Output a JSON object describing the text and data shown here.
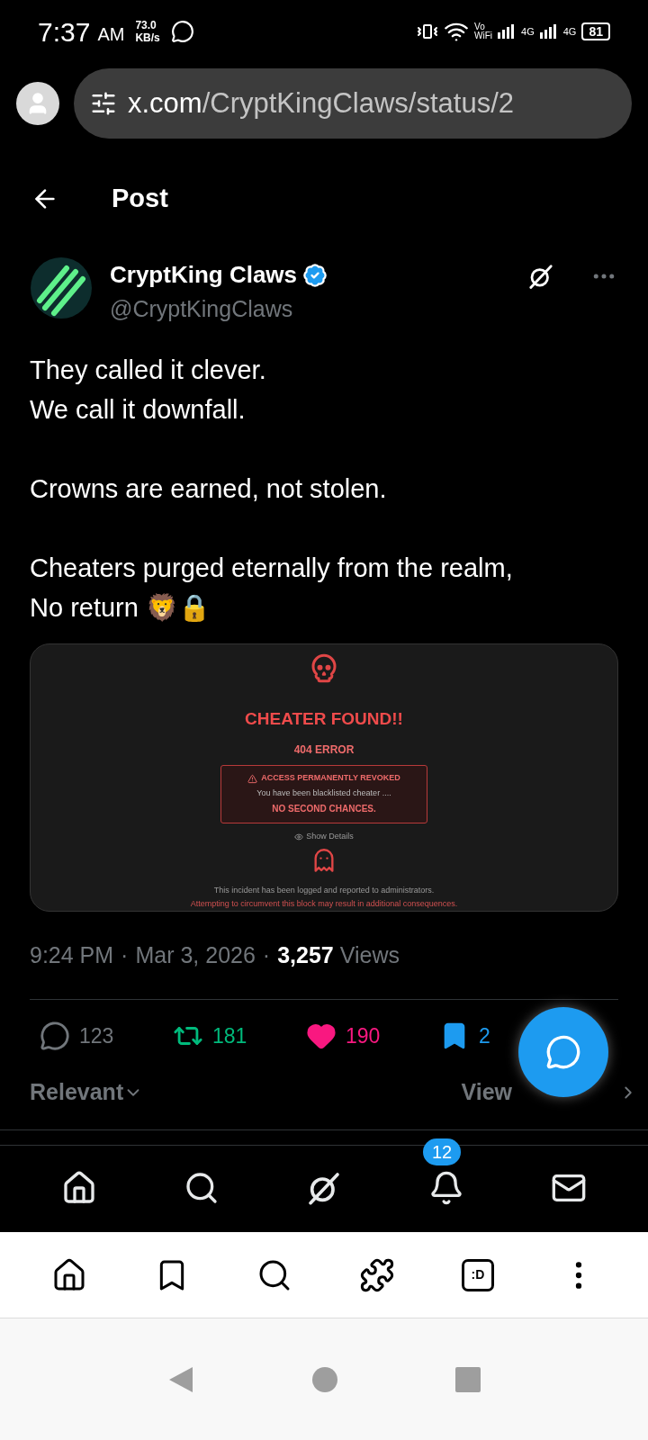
{
  "status_bar": {
    "time": "7:37",
    "ampm": "AM",
    "speed": "73.0",
    "speed_unit": "KB/s",
    "vo": "Vo",
    "wifi": "WiFi",
    "net1": "4G",
    "net2": "4G",
    "battery": "81"
  },
  "browser": {
    "url_host": "x.com",
    "url_path": "/CryptKingClaws/status/2"
  },
  "header": {
    "title": "Post"
  },
  "author": {
    "name": "CryptKing Claws",
    "handle": "@CryptKingClaws",
    "verified": true
  },
  "post": {
    "paragraphs": [
      [
        "They called it clever.",
        "We call it downfall."
      ],
      [
        "Crowns are earned, not stolen."
      ],
      [
        "Cheaters purged eternally from the realm,",
        "No return 🦁🔒"
      ]
    ],
    "embed": {
      "title": "CHEATER FOUND!!",
      "code": "404 ERROR",
      "notice_title": "ACCESS PERMANENTLY REVOKED",
      "notice_text": "You have been blacklisted cheater ....",
      "notice_strong": "NO SECOND CHANCES.",
      "details": "Show Details",
      "footer1": "This incident has been logged and reported to administrators.",
      "footer2": "Attempting to circumvent this block may result in additional consequences."
    },
    "time": "9:24 PM",
    "sep1": "·",
    "date": "Mar 3, 2026",
    "sep2": "·",
    "views": "3,257",
    "views_label": "Views"
  },
  "actions": [
    {
      "kind": "reply",
      "count": "123",
      "active": false
    },
    {
      "kind": "repost",
      "count": "181",
      "active": true
    },
    {
      "kind": "like",
      "count": "190",
      "active": true
    },
    {
      "kind": "bookmark",
      "count": "2",
      "active": true
    }
  ],
  "sort": {
    "label": "Relevant",
    "quotes": "View"
  },
  "bottom_nav": [
    {
      "kind": "home",
      "selected": false
    },
    {
      "kind": "search",
      "selected": false
    },
    {
      "kind": "grok",
      "selected": false
    },
    {
      "kind": "notifications",
      "selected": false,
      "badge": "12"
    },
    {
      "kind": "messages",
      "selected": false
    }
  ],
  "browser_bar": [
    {
      "kind": "home"
    },
    {
      "kind": "bookmark"
    },
    {
      "kind": "search"
    },
    {
      "kind": "extensions"
    },
    {
      "kind": "tabs",
      "label": ":D"
    },
    {
      "kind": "menu"
    }
  ]
}
